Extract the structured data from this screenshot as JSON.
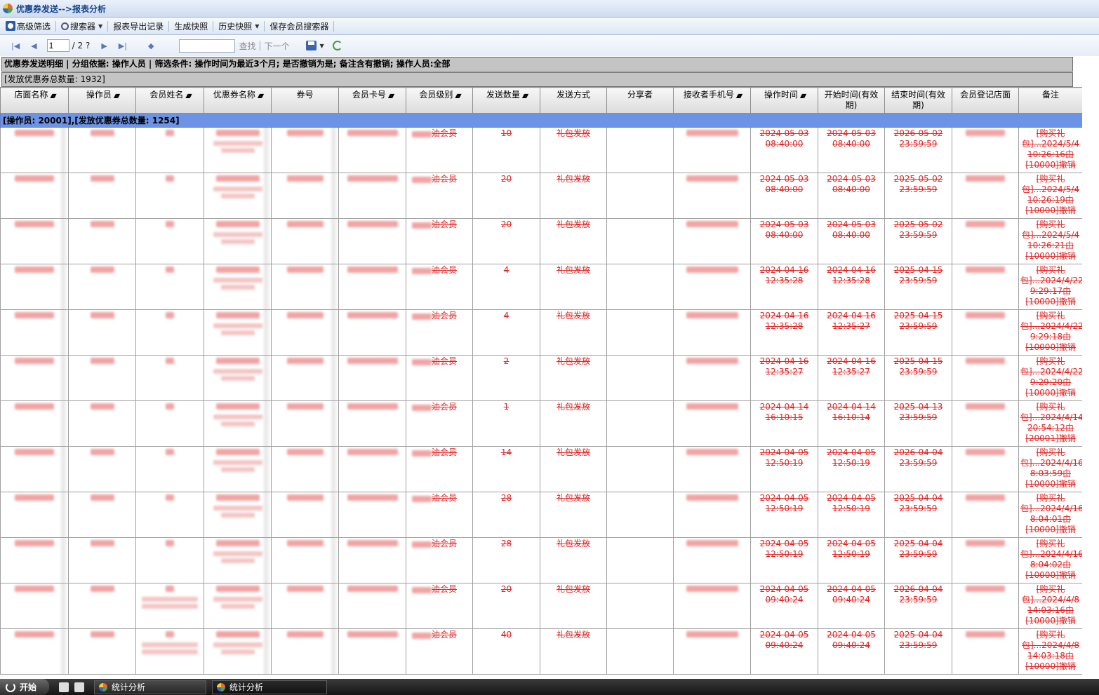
{
  "window": {
    "title": "优惠券发送-->报表分析"
  },
  "menu": [
    {
      "label": "高级筛选",
      "icon": "filter-icon",
      "dropdown": false
    },
    {
      "label": "搜索器",
      "icon": "search-icon",
      "dropdown": true
    },
    {
      "label": "报表导出记录",
      "icon": "",
      "dropdown": false
    },
    {
      "label": "生成快照",
      "icon": "",
      "dropdown": false
    },
    {
      "label": "历史快照",
      "icon": "",
      "dropdown": true
    },
    {
      "label": "保存会员搜索器",
      "icon": "",
      "dropdown": false
    }
  ],
  "pager": {
    "current_page": "1",
    "total": "/ 2 ?",
    "find_label": "查找",
    "next_label": "下一个",
    "search_value": ""
  },
  "report": {
    "info_line": "优惠券发送明细 | 分组依据: 操作人员 | 筛选条件: 操作时间为最近3个月; 是否撤销为是; 备注含有撤销; 操作人员:全部",
    "total_line": "[发放优惠券总数量: 1932]"
  },
  "columns": [
    "店面名称",
    "操作员",
    "会员姓名",
    "优惠券名称",
    "券号",
    "会员卡号",
    "会员级别",
    "发送数量",
    "发送方式",
    "分享者",
    "接收者手机号",
    "操作时间",
    "开始时间(有效期)",
    "结束时间(有效期)",
    "会员登记店面",
    "备注"
  ],
  "group_header": "[操作员: 20001],[发放优惠券总数量: 1254]",
  "rows": [
    {
      "level": "油会员",
      "qty": "10",
      "method": "礼包发放",
      "op_time": "2024-05-03 08:40:00",
      "start": "2024-05-03 08:40:00",
      "end": "2026-05-02 23:59:59",
      "remark": "[购买礼包]...2024/5/4 10:26:16由[10000]撤销"
    },
    {
      "level": "油会员",
      "qty": "20",
      "method": "礼包发放",
      "op_time": "2024-05-03 08:40:00",
      "start": "2024-05-03 08:40:00",
      "end": "2025-05-02 23:59:59",
      "remark": "[购买礼包]...2024/5/4 10:26:19由[10000]撤销"
    },
    {
      "level": "油会员",
      "qty": "20",
      "method": "礼包发放",
      "op_time": "2024-05-03 08:40:00",
      "start": "2024-05-03 08:40:00",
      "end": "2025-05-02 23:59:59",
      "remark": "[购买礼包]...2024/5/4 10:26:21由[10000]撤销"
    },
    {
      "level": "油会员",
      "qty": "4",
      "method": "礼包发放",
      "op_time": "2024-04-16 12:35:28",
      "start": "2024-04-16 12:35:28",
      "end": "2025-04-15 23:59:59",
      "remark": "[购买礼包]...2024/4/22 9:29:17由[10000]撤销"
    },
    {
      "level": "油会员",
      "qty": "4",
      "method": "礼包发放",
      "op_time": "2024-04-16 12:35:28",
      "start": "2024-04-16 12:35:27",
      "end": "2025-04-15 23:59:59",
      "remark": "[购买礼包]...2024/4/22 9:29:18由[10000]撤销"
    },
    {
      "level": "油会员",
      "qty": "2",
      "method": "礼包发放",
      "op_time": "2024-04-16 12:35:27",
      "start": "2024-04-16 12:35:27",
      "end": "2025-04-15 23:59:59",
      "remark": "[购买礼包]...2024/4/22 9:29:20由[10000]撤销"
    },
    {
      "level": "油会员",
      "qty": "1",
      "method": "礼包发放",
      "op_time": "2024-04-14 16:10:15",
      "start": "2024-04-14 16:10:14",
      "end": "2025-04-13 23:59:59",
      "remark": "[购买礼包]...2024/4/14 20:54:12由[20001]撤销"
    },
    {
      "level": "油会员",
      "qty": "14",
      "method": "礼包发放",
      "op_time": "2024-04-05 12:50:19",
      "start": "2024-04-05 12:50:19",
      "end": "2026-04-04 23:59:59",
      "remark": "[购买礼包]...2024/4/16 8:03:59由[10000]撤销"
    },
    {
      "level": "油会员",
      "qty": "28",
      "method": "礼包发放",
      "op_time": "2024-04-05 12:50:19",
      "start": "2024-04-05 12:50:19",
      "end": "2025-04-04 23:59:59",
      "remark": "[购买礼包]...2024/4/16 8:04:01由[10000]撤销"
    },
    {
      "level": "油会员",
      "qty": "28",
      "method": "礼包发放",
      "op_time": "2024-04-05 12:50:19",
      "start": "2024-04-05 12:50:19",
      "end": "2025-04-04 23:59:59",
      "remark": "[购买礼包]...2024/4/16 8:04:02由[10000]撤销"
    },
    {
      "level": "油会员",
      "qty": "20",
      "method": "礼包发放",
      "op_time": "2024-04-05 09:40:24",
      "start": "2024-04-05 09:40:24",
      "end": "2026-04-04 23:59:59",
      "remark": "[购买礼包]...2024/4/8 14:03:16由[10000]撤销"
    },
    {
      "level": "油会员",
      "qty": "40",
      "method": "礼包发放",
      "op_time": "2024-04-05 09:40:24",
      "start": "2024-04-05 09:40:24",
      "end": "2025-04-04 23:59:59",
      "remark": "[购买礼包]...2024/4/8 14:03:18由[10000]撤销"
    }
  ],
  "taskbar": {
    "start": "开始",
    "tasks": [
      "统计分析",
      "统计分析"
    ]
  },
  "colors": {
    "group_header": "#6c93e6",
    "revoked_text": "#e52525",
    "header_band": "#c4c4c4"
  }
}
